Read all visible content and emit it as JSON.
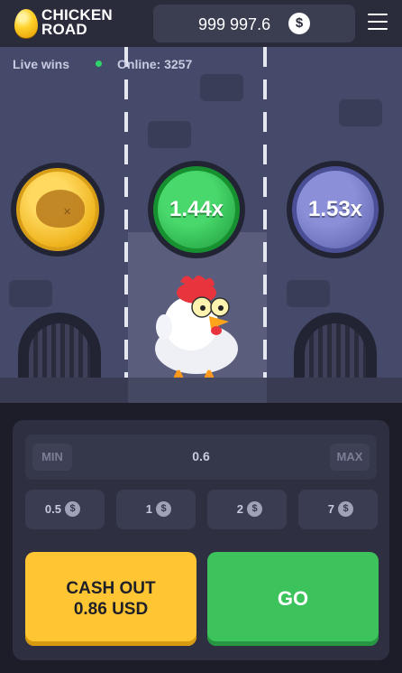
{
  "header": {
    "logo_line1": "CHICKEN",
    "logo_line2": "ROAD",
    "balance": "999 997.6",
    "currency_symbol": "$"
  },
  "scene": {
    "live_wins_label": "Live wins",
    "online_label": "Online: 3257",
    "multipliers": [
      "1.44x",
      "1.53x"
    ]
  },
  "controls": {
    "min_label": "MIN",
    "max_label": "MAX",
    "bet_value": "0.6",
    "chip_symbol": "$",
    "quick_bets": [
      "0.5",
      "1",
      "2",
      "7"
    ],
    "cashout_label": "CASH OUT",
    "cashout_amount": "0.86 USD",
    "go_label": "GO"
  },
  "colors": {
    "background": "#1c1d29",
    "header": "#2a2c3c",
    "cashout_yellow": "#ffc533",
    "go_green": "#3dc35c",
    "coin_gold": "#f0b520",
    "coin_green": "#1e9a3c",
    "coin_blue": "#5a5fa8"
  }
}
